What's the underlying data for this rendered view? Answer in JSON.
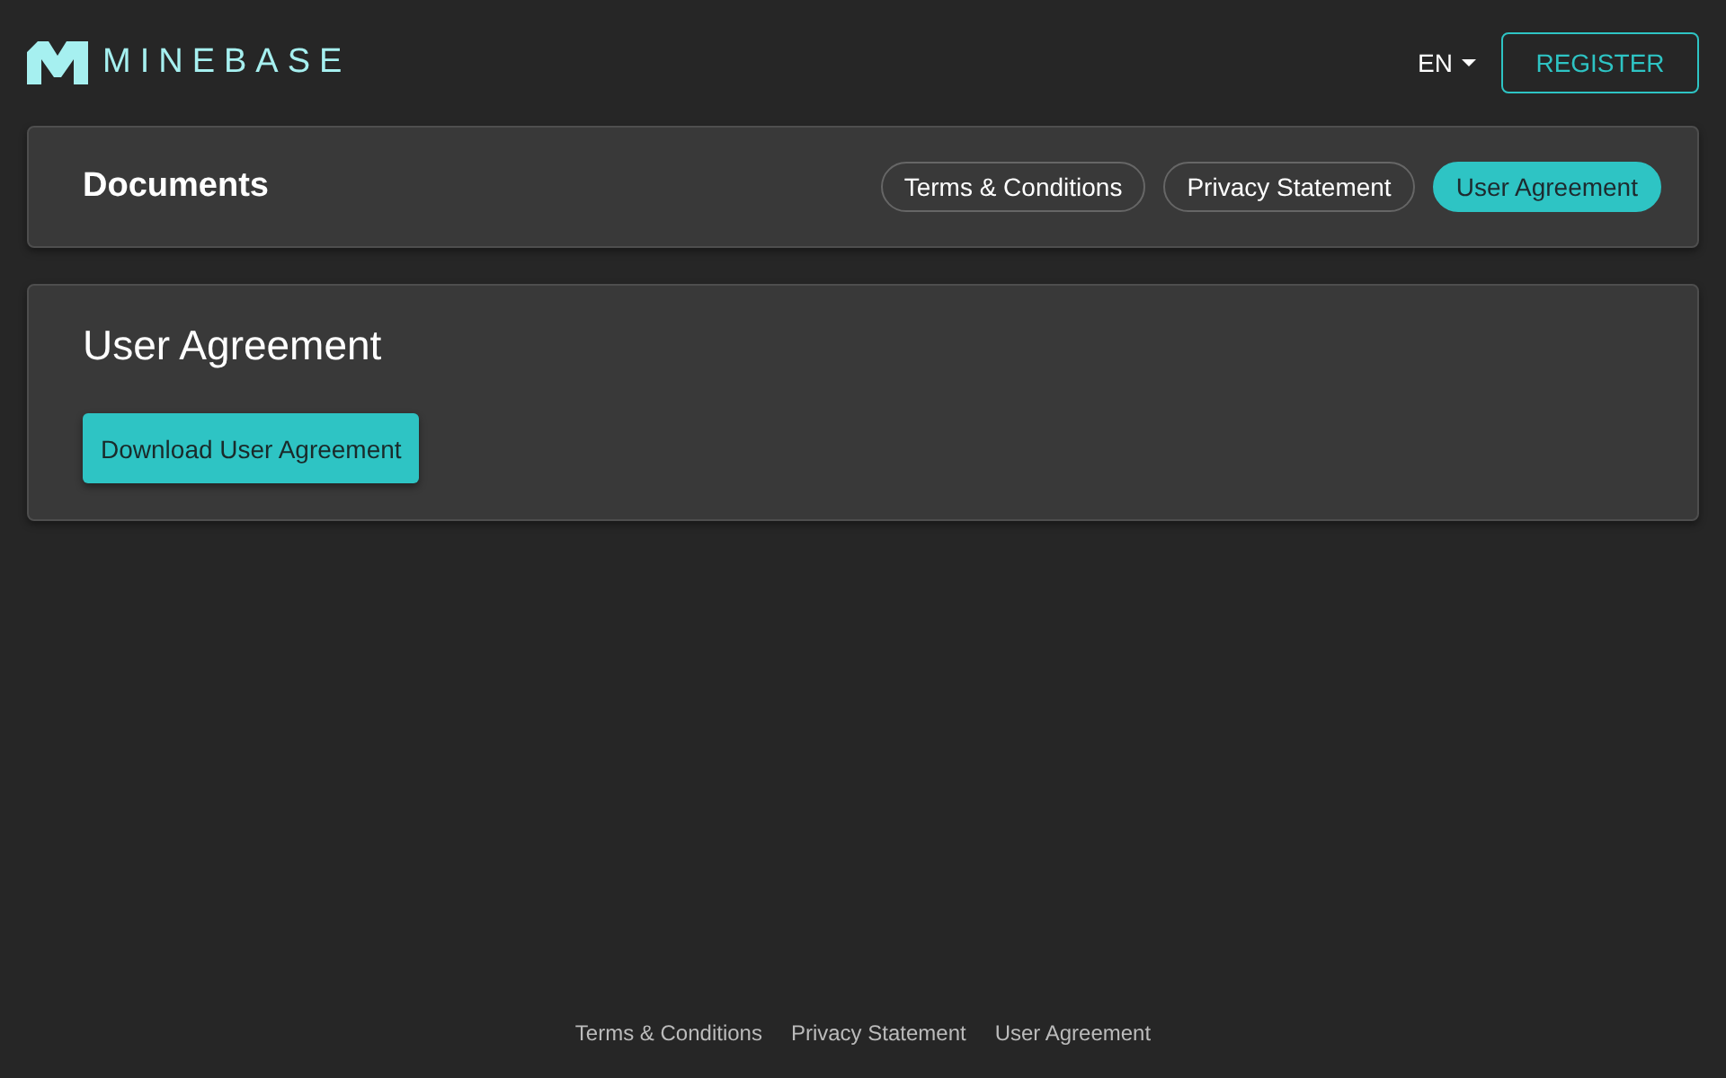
{
  "header": {
    "logo_text": "MINEBASE",
    "language": "EN",
    "register_button": "REGISTER"
  },
  "documents_bar": {
    "title": "Documents",
    "tabs": [
      {
        "label": "Terms & Conditions",
        "selected": false
      },
      {
        "label": "Privacy Statement",
        "selected": false
      },
      {
        "label": "User Agreement",
        "selected": true
      }
    ]
  },
  "document": {
    "title": "User Agreement",
    "download_button": "Download User Agreement"
  },
  "footer": {
    "links": [
      "Terms & Conditions",
      "Privacy Statement",
      "User Agreement"
    ]
  }
}
